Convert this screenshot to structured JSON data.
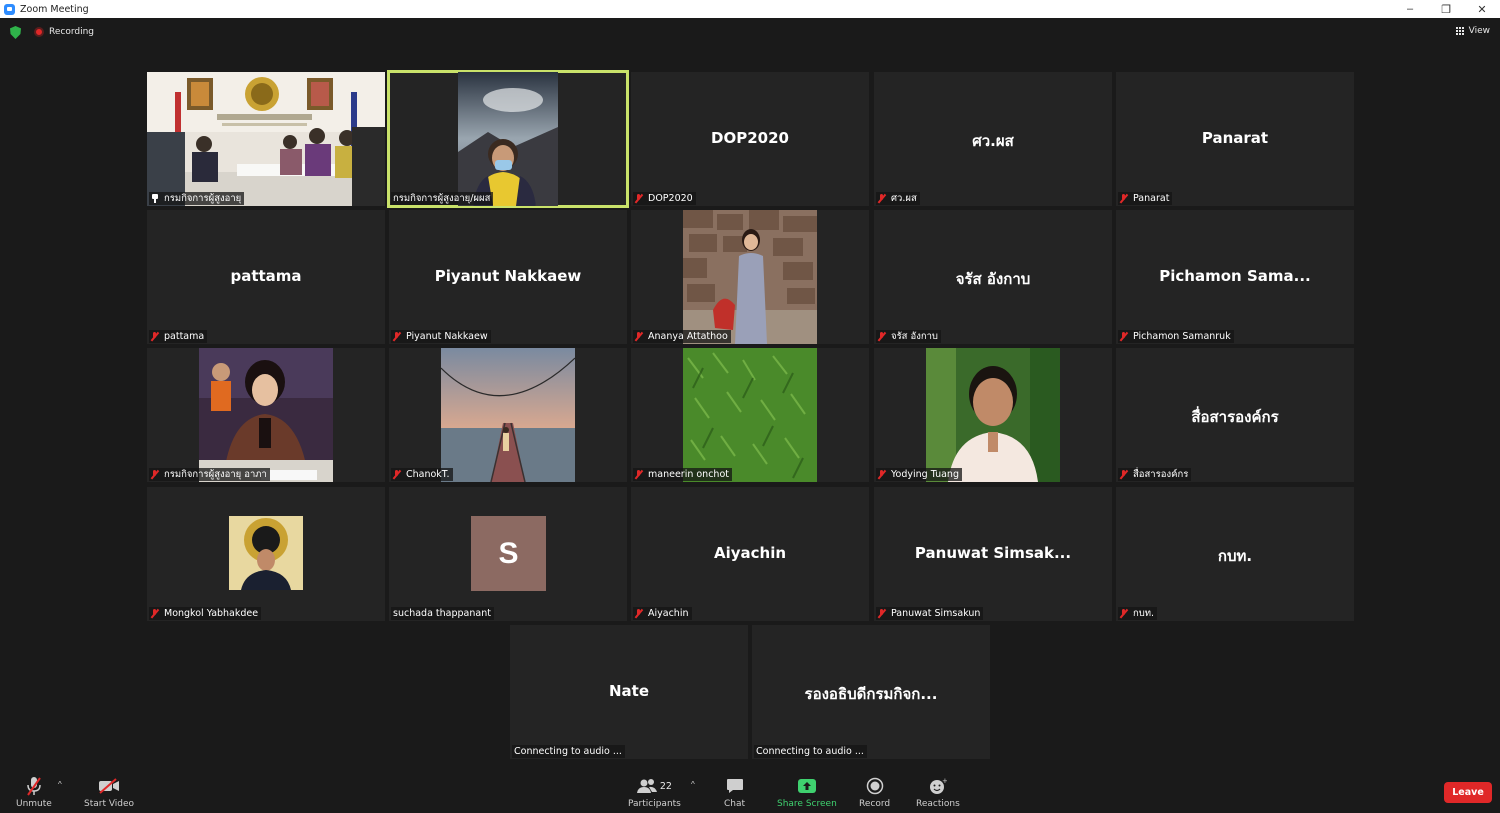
{
  "window": {
    "title": "Zoom Meeting",
    "controls": [
      "–",
      "❐",
      "✕"
    ]
  },
  "topbar": {
    "recording_label": "Recording",
    "view_label": "View"
  },
  "tiles": [
    {
      "display": "",
      "label": "กรมกิจการผู้สูงอายุ",
      "icon": "pin"
    },
    {
      "display": "",
      "label": "กรมกิจการผู้สูงอายุ/ผผส",
      "icon": "none",
      "active": true
    },
    {
      "display": "DOP2020",
      "label": "DOP2020",
      "icon": "muted"
    },
    {
      "display": "ศว.ผส",
      "label": "ศว.ผส",
      "icon": "muted"
    },
    {
      "display": "Panarat",
      "label": "Panarat",
      "icon": "muted"
    },
    {
      "display": "pattama",
      "label": "pattama",
      "icon": "muted"
    },
    {
      "display": "Piyanut Nakkaew",
      "label": "Piyanut Nakkaew",
      "icon": "muted"
    },
    {
      "display": "",
      "label": "Ananya Attathoo",
      "icon": "muted"
    },
    {
      "display": "จรัส อังกาบ",
      "label": "จรัส อังกาบ",
      "icon": "muted"
    },
    {
      "display": "Pichamon Sama...",
      "label": "Pichamon Samanruk",
      "icon": "muted"
    },
    {
      "display": "",
      "label": "กรมกิจการผู้สูงอายุ อาภา",
      "icon": "muted"
    },
    {
      "display": "",
      "label": "ChanokT.",
      "icon": "muted"
    },
    {
      "display": "",
      "label": "maneerin onchot",
      "icon": "muted"
    },
    {
      "display": "",
      "label": "Yodying Tuang",
      "icon": "muted"
    },
    {
      "display": "สื่อสารองค์กร",
      "label": "สื่อสารองค์กร",
      "icon": "muted"
    },
    {
      "display": "",
      "label": "Mongkol Yabhakdee",
      "icon": "muted"
    },
    {
      "display": "S",
      "label": "suchada thappanant",
      "icon": "none"
    },
    {
      "display": "Aiyachin",
      "label": "Aiyachin",
      "icon": "muted"
    },
    {
      "display": "Panuwat Simsak...",
      "label": "Panuwat Simsakun",
      "icon": "muted"
    },
    {
      "display": "กบท.",
      "label": "กบท.",
      "icon": "muted"
    },
    {
      "display": "Nate",
      "label": "Connecting to audio ...",
      "icon": "none"
    },
    {
      "display": "รองอธิบดีกรมกิจก...",
      "label": "Connecting to audio ...",
      "icon": "none"
    }
  ],
  "toolbar": {
    "unmute": "Unmute",
    "start_video": "Start Video",
    "participants": "Participants",
    "participants_count": "22",
    "chat": "Chat",
    "share_screen": "Share Screen",
    "record": "Record",
    "reactions": "Reactions",
    "leave": "Leave"
  },
  "colors": {
    "active_speaker": "#c9e26a",
    "leave": "#e02828",
    "share": "#3fd16f",
    "background": "#1a1a1a",
    "tile": "#242424"
  }
}
